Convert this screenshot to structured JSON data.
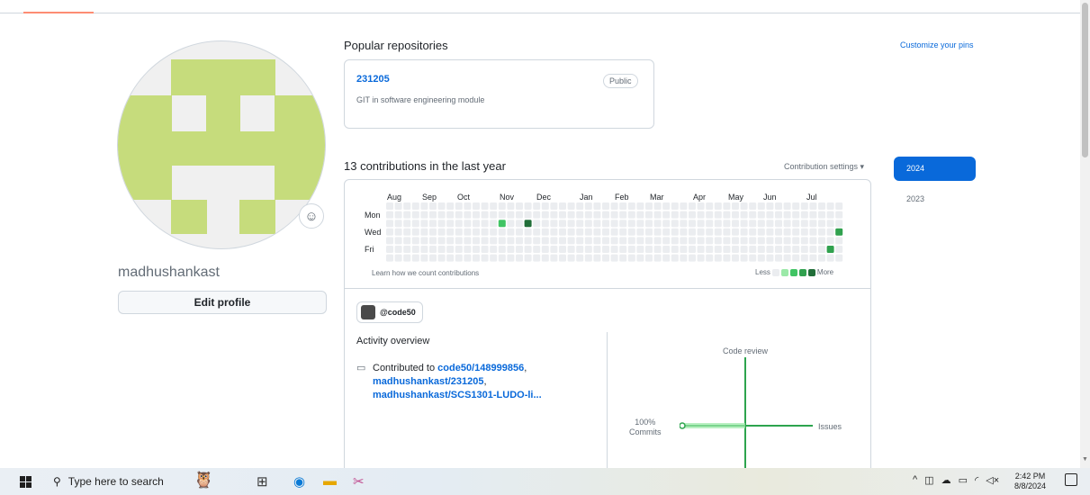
{
  "profile": {
    "username": "madhushankast",
    "edit_label": "Edit profile",
    "emoji_icon": "smiley-icon"
  },
  "pinned": {
    "title": "Popular repositories",
    "customize": "Customize your pins",
    "repo": {
      "name": "231205",
      "visibility": "Public",
      "description": "GIT in software engineering module"
    }
  },
  "contributions": {
    "title": "13 contributions in the last year",
    "settings": "Contribution settings ▾",
    "months": [
      "Aug",
      "Sep",
      "Oct",
      "Nov",
      "Dec",
      "Jan",
      "Feb",
      "Mar",
      "Apr",
      "May",
      "Jun",
      "Jul"
    ],
    "days": [
      "Mon",
      "Wed",
      "Fri"
    ],
    "learn": "Learn how we count contributions",
    "legend_less": "Less",
    "legend_more": "More",
    "colors": [
      "#ebedf0",
      "#9be9a8",
      "#40c463",
      "#30a14e",
      "#216e39"
    ]
  },
  "activity": {
    "org": "@code50",
    "title": "Activity overview",
    "contributed_prefix": "Contributed to ",
    "repos": [
      "code50/148999856",
      "madhushankast/231205",
      "madhushankast/SCS1301-LUDO-li..."
    ],
    "code_review": "Code review",
    "issues": "Issues",
    "commits_pct": "100%",
    "commits": "Commits"
  },
  "years": [
    "2024",
    "2023"
  ],
  "taskbar": {
    "search_placeholder": "Type here to search",
    "time": "2:42 PM",
    "date": "8/8/2024"
  }
}
